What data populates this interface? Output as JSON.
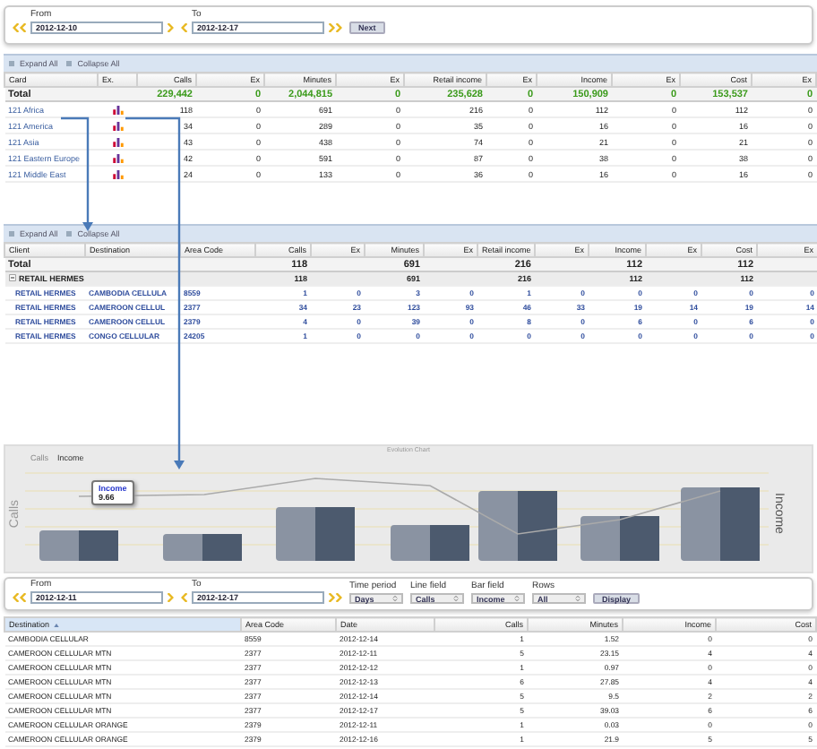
{
  "top_filter": {
    "from_label": "From",
    "from_value": "2012-12-10",
    "to_label": "To",
    "to_value": "2012-12-17",
    "next_button": "Next"
  },
  "card_grid": {
    "toolbar": [
      "Expand All",
      "Collapse All"
    ],
    "columns": [
      "Card",
      "Ex.",
      "Calls",
      "Ex",
      "Minutes",
      "Ex",
      "Retail income",
      "Ex",
      "Income",
      "Ex",
      "Cost",
      "Ex"
    ],
    "total": {
      "label": "Total",
      "values": [
        "229,442",
        "0",
        "2,044,815",
        "0",
        "235,628",
        "0",
        "150,909",
        "0",
        "153,537",
        "0"
      ]
    },
    "rows": [
      {
        "name": "121 Africa",
        "values": [
          "118",
          "0",
          "691",
          "0",
          "216",
          "0",
          "112",
          "0",
          "112",
          "0"
        ]
      },
      {
        "name": "121 America",
        "values": [
          "34",
          "0",
          "289",
          "0",
          "35",
          "0",
          "16",
          "0",
          "16",
          "0"
        ]
      },
      {
        "name": "121 Asia",
        "values": [
          "43",
          "0",
          "438",
          "0",
          "74",
          "0",
          "21",
          "0",
          "21",
          "0"
        ]
      },
      {
        "name": "121 Eastern Europe",
        "values": [
          "42",
          "0",
          "591",
          "0",
          "87",
          "0",
          "38",
          "0",
          "38",
          "0"
        ]
      },
      {
        "name": "121 Middle East",
        "values": [
          "24",
          "0",
          "133",
          "0",
          "36",
          "0",
          "16",
          "0",
          "16",
          "0"
        ]
      }
    ]
  },
  "client_grid": {
    "toolbar": [
      "Expand All",
      "Collapse All"
    ],
    "columns": [
      "Client",
      "Destination",
      "Area Code",
      "Calls",
      "Ex",
      "Minutes",
      "Ex",
      "Retail income",
      "Ex",
      "Income",
      "Ex",
      "Cost",
      "Ex"
    ],
    "total": {
      "label": "Total",
      "values": {
        "calls": "118",
        "minutes": "691",
        "retail_income": "216",
        "income": "112",
        "cost": "112"
      }
    },
    "group": {
      "label": "RETAIL HERMES",
      "expanded": true,
      "values": {
        "calls": "118",
        "minutes": "691",
        "retail_income": "216",
        "income": "112",
        "cost": "112"
      }
    },
    "rows": [
      {
        "client": "RETAIL HERMES",
        "destination": "CAMBODIA CELLULA",
        "area_code": "8559",
        "values": [
          "1",
          "0",
          "3",
          "0",
          "1",
          "0",
          "0",
          "0",
          "0",
          "0"
        ]
      },
      {
        "client": "RETAIL HERMES",
        "destination": "CAMEROON CELLUL",
        "area_code": "2377",
        "values": [
          "34",
          "23",
          "123",
          "93",
          "46",
          "33",
          "19",
          "14",
          "19",
          "14"
        ]
      },
      {
        "client": "RETAIL HERMES",
        "destination": "CAMEROON CELLUL",
        "area_code": "2379",
        "values": [
          "4",
          "0",
          "39",
          "0",
          "8",
          "0",
          "6",
          "0",
          "6",
          "0"
        ]
      },
      {
        "client": "RETAIL HERMES",
        "destination": "CONGO CELLULAR",
        "area_code": "24205",
        "values": [
          "1",
          "0",
          "0",
          "0",
          "0",
          "0",
          "0",
          "0",
          "0",
          "0"
        ]
      }
    ]
  },
  "chart": {
    "title": "Evolution Chart",
    "legend": [
      "Calls",
      "Income"
    ],
    "y_left_title": "Calls",
    "y_right_title": "Income",
    "tooltip": {
      "series": "Income",
      "value": "9.66"
    }
  },
  "chart_filter": {
    "from_label": "From",
    "from_value": "2012-12-11",
    "to_label": "To",
    "to_value": "2012-12-17",
    "selects": [
      {
        "label": "Time period",
        "value": "Days"
      },
      {
        "label": "Line field",
        "value": "Calls"
      },
      {
        "label": "Bar field",
        "value": "Income"
      },
      {
        "label": "Rows",
        "value": "All"
      }
    ],
    "display_button": "Display"
  },
  "detail_table": {
    "columns": [
      {
        "label": "Destination",
        "sorted": true
      },
      {
        "label": "Area Code",
        "sorted": false
      },
      {
        "label": "Date",
        "sorted": false
      },
      {
        "label": "Calls",
        "sorted": false
      },
      {
        "label": "Minutes",
        "sorted": false
      },
      {
        "label": "Income",
        "sorted": false
      },
      {
        "label": "Cost",
        "sorted": false
      }
    ],
    "rows": [
      [
        "CAMBODIA CELLULAR",
        "8559",
        "2012-12-14",
        "1",
        "1.52",
        "0",
        "0"
      ],
      [
        "CAMEROON CELLULAR MTN",
        "2377",
        "2012-12-11",
        "5",
        "23.15",
        "4",
        "4"
      ],
      [
        "CAMEROON CELLULAR MTN",
        "2377",
        "2012-12-12",
        "1",
        "0.97",
        "0",
        "0"
      ],
      [
        "CAMEROON CELLULAR MTN",
        "2377",
        "2012-12-13",
        "6",
        "27.85",
        "4",
        "4"
      ],
      [
        "CAMEROON CELLULAR MTN",
        "2377",
        "2012-12-14",
        "5",
        "9.5",
        "2",
        "2"
      ],
      [
        "CAMEROON CELLULAR MTN",
        "2377",
        "2012-12-17",
        "5",
        "39.03",
        "6",
        "6"
      ],
      [
        "CAMEROON CELLULAR ORANGE",
        "2379",
        "2012-12-11",
        "1",
        "0.03",
        "0",
        "0"
      ],
      [
        "CAMEROON CELLULAR ORANGE",
        "2379",
        "2012-12-16",
        "1",
        "21.9",
        "5",
        "5"
      ]
    ]
  }
}
